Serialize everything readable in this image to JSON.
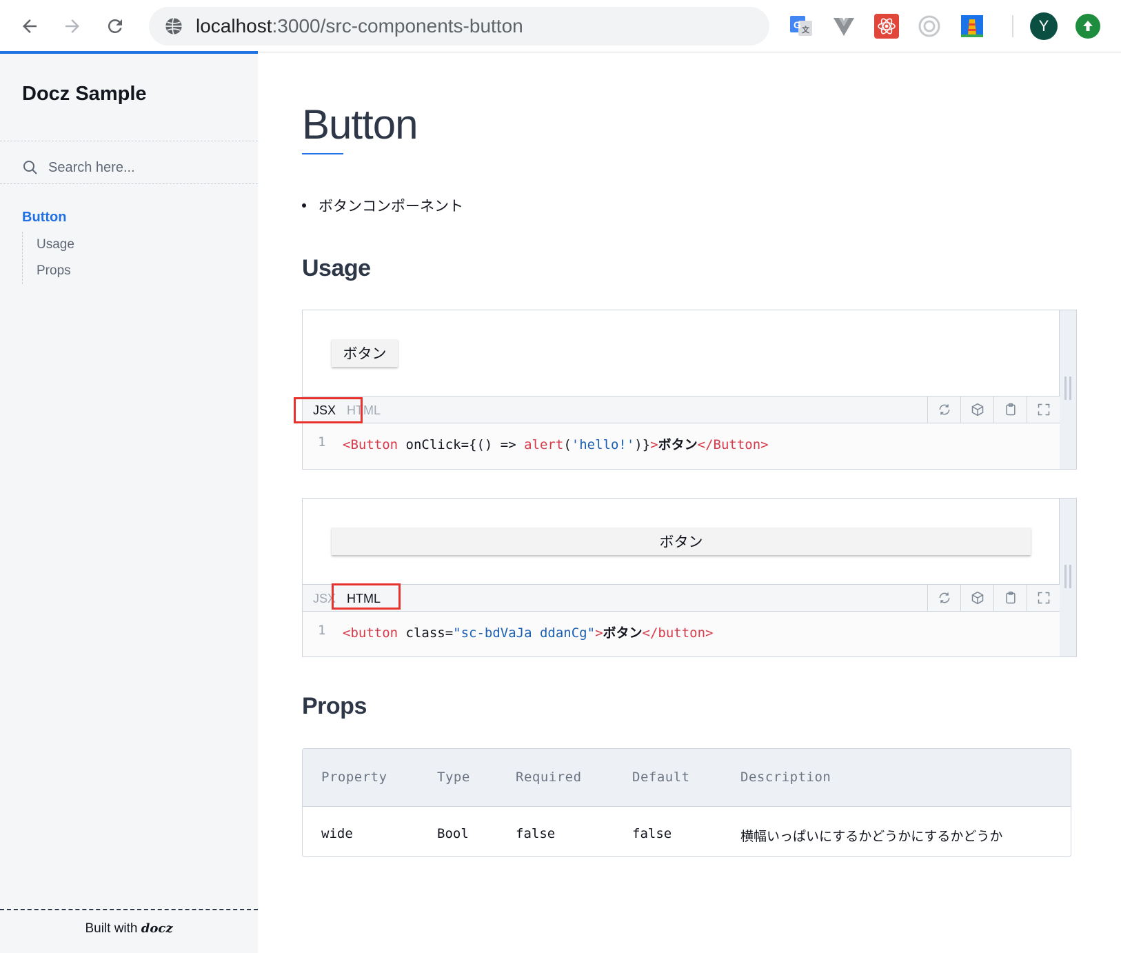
{
  "browser": {
    "url_host": "localhost",
    "url_rest": ":3000/src-components-button",
    "avatar_letter": "Y",
    "extensions": [
      "google-translate-icon",
      "vue-devtools-icon",
      "react-devtools-icon",
      "extension-ring-icon",
      "lighthouse-icon"
    ]
  },
  "sidebar": {
    "brand": "Docz Sample",
    "search_placeholder": "Search here...",
    "nav_main": "Button",
    "subnav": [
      "Usage",
      "Props"
    ],
    "built_with": "Built with",
    "built_logo": "docz"
  },
  "main": {
    "title": "Button",
    "bullet": "ボタンコンポーネント",
    "usage_heading": "Usage",
    "props_heading": "Props"
  },
  "playground1": {
    "button_label": "ボタン",
    "tab_jsx": "JSX",
    "tab_html": "HTML",
    "active_tab": "JSX",
    "line_no": "1",
    "code": {
      "open_tag": "<Button",
      "attr": " onClick={() => ",
      "fn": "alert",
      "paren_open": "(",
      "str": "'hello!'",
      "paren_close": ")}",
      "gt": ">",
      "text": "ボタン",
      "close_tag": "</Button>"
    }
  },
  "playground2": {
    "button_label": "ボタン",
    "tab_jsx": "JSX",
    "tab_html": "HTML",
    "active_tab": "HTML",
    "line_no": "1",
    "code": {
      "open_tag": "<button",
      "attr": " class=",
      "str": "\"sc-bdVaJa ddanCg\"",
      "gt": ">",
      "text": "ボタン",
      "close_tag": "</button>"
    }
  },
  "props_table": {
    "headers": [
      "Property",
      "Type",
      "Required",
      "Default",
      "Description"
    ],
    "rows": [
      [
        "wide",
        "Bool",
        "false",
        "false",
        "横幅いっぱいにするかどうかにするかどうか"
      ]
    ]
  },
  "colors": {
    "accent": "#1f6fe5",
    "highlight_box": "#e8322e",
    "sidebar_bg": "#f5f6f7"
  }
}
